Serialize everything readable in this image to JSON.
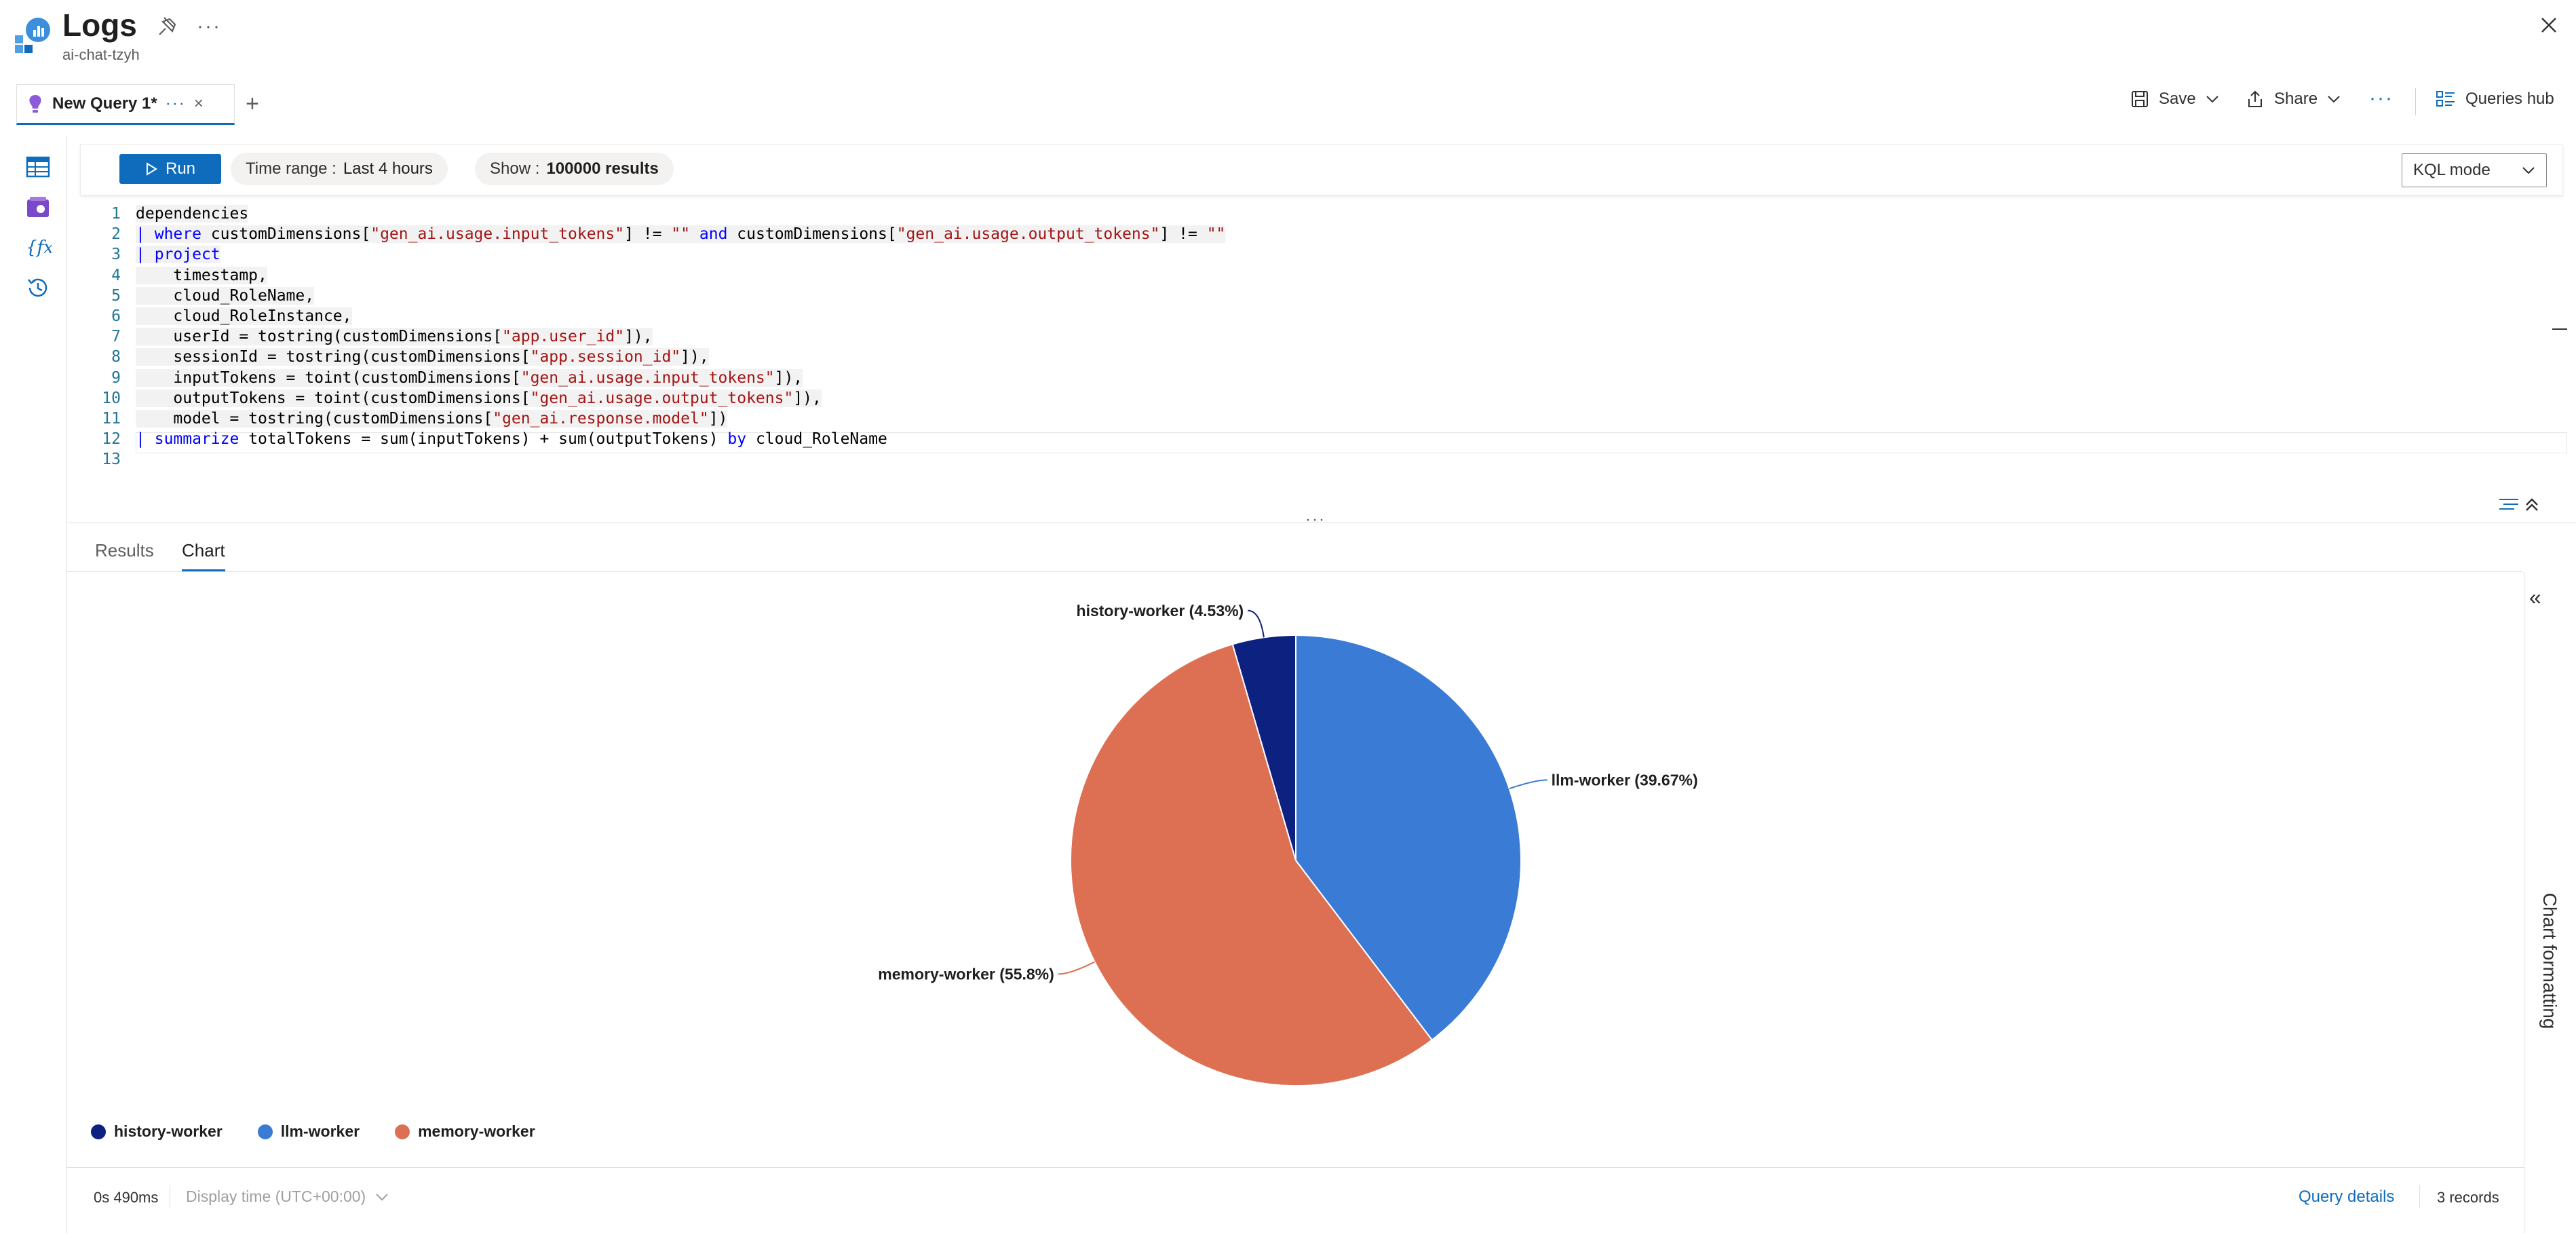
{
  "header": {
    "title": "Logs",
    "subtitle": "ai-chat-tzyh",
    "more": "···"
  },
  "tab": {
    "label": "New Query 1*",
    "more": "···",
    "close": "×",
    "add": "+"
  },
  "toolbar": {
    "save_label": "Save",
    "share_label": "Share",
    "more": "···",
    "queries_hub_label": "Queries hub"
  },
  "query_toolbar": {
    "run_label": "Run",
    "time_range_label": "Time range :",
    "time_range_value": "Last 4 hours",
    "show_label": "Show :",
    "show_value": "100000 results",
    "mode_value": "KQL mode"
  },
  "editor": {
    "line_numbers": [
      "1",
      "2",
      "3",
      "4",
      "5",
      "6",
      "7",
      "8",
      "9",
      "10",
      "11",
      "12",
      "13"
    ]
  },
  "splitter": "···",
  "result_tabs": {
    "results": "Results",
    "chart": "Chart"
  },
  "chart_panel": {
    "label": "Chart formatting",
    "chevron": "«"
  },
  "chart_data": {
    "type": "pie",
    "slices": [
      {
        "name": "llm-worker",
        "label": "llm-worker (39.67%)",
        "value": 39.67,
        "color": "#3a7bd5"
      },
      {
        "name": "memory-worker",
        "label": "memory-worker (55.8%)",
        "value": 55.8,
        "color": "#dd7053"
      },
      {
        "name": "history-worker",
        "label": "history-worker (4.53%)",
        "value": 4.53,
        "color": "#0d2181"
      }
    ],
    "legend": [
      {
        "name": "history-worker",
        "color": "#0d2181"
      },
      {
        "name": "llm-worker",
        "color": "#3a7bd5"
      },
      {
        "name": "memory-worker",
        "color": "#dd7053"
      }
    ],
    "legend_position": "bottom-left"
  },
  "footer": {
    "exec_time": "0s 490ms",
    "display_time": "Display time (UTC+00:00)",
    "query_details": "Query details",
    "records": "3 records"
  }
}
